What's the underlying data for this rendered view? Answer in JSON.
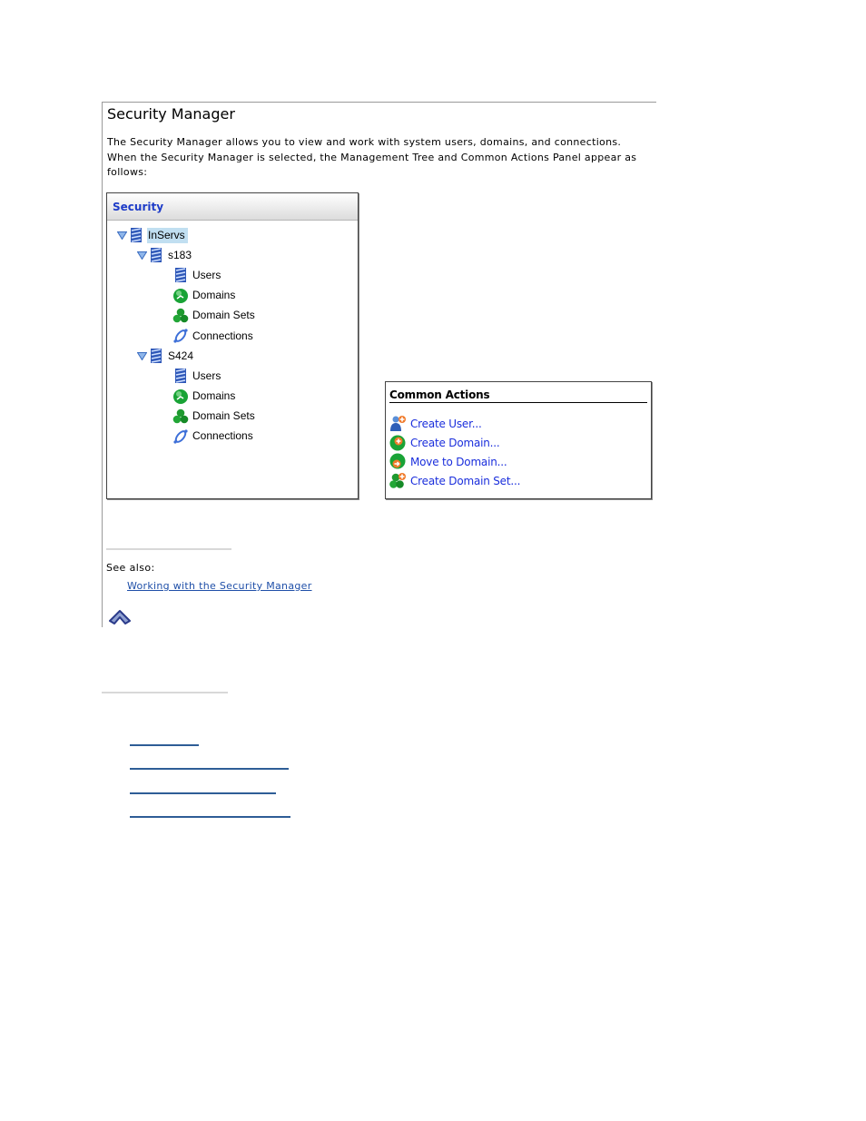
{
  "document": {
    "title": "Security Manager",
    "intro": "The Security Manager allows you to view and work with system users, domains, and connections. When the Security Manager is selected, the Management Tree and Common Actions Panel appear as follows:"
  },
  "tree_panel": {
    "header": "Security",
    "nodes": [
      {
        "label": "InServs",
        "icon": "storage-system-icon",
        "expanded": true,
        "selected": true
      },
      {
        "label": "s183",
        "icon": "storage-system-icon",
        "expanded": true
      },
      {
        "label": "Users",
        "icon": "users-icon"
      },
      {
        "label": "Domains",
        "icon": "domain-globe-icon"
      },
      {
        "label": "Domain Sets",
        "icon": "domain-sets-icon"
      },
      {
        "label": "Connections",
        "icon": "connection-link-icon"
      },
      {
        "label": "S424",
        "icon": "storage-system-icon",
        "expanded": true
      },
      {
        "label": "Users",
        "icon": "users-icon"
      },
      {
        "label": "Domains",
        "icon": "domain-globe-icon"
      },
      {
        "label": "Domain Sets",
        "icon": "domain-sets-icon"
      },
      {
        "label": "Connections",
        "icon": "connection-link-icon"
      }
    ]
  },
  "actions_panel": {
    "title": "Common Actions",
    "items": [
      {
        "label": "Create User...",
        "icon": "create-user-icon"
      },
      {
        "label": "Create Domain...",
        "icon": "create-domain-icon"
      },
      {
        "label": "Move to Domain...",
        "icon": "move-to-domain-icon"
      },
      {
        "label": "Create Domain Set...",
        "icon": "create-domain-set-icon"
      }
    ]
  },
  "see_also": {
    "label": "See also:",
    "link": "Working with the Security Manager"
  },
  "colors": {
    "link": "#1f4fa8",
    "action_link": "#1a2edc",
    "panel_header_text": "#1e3cc8",
    "selection": "#c1dff1"
  }
}
